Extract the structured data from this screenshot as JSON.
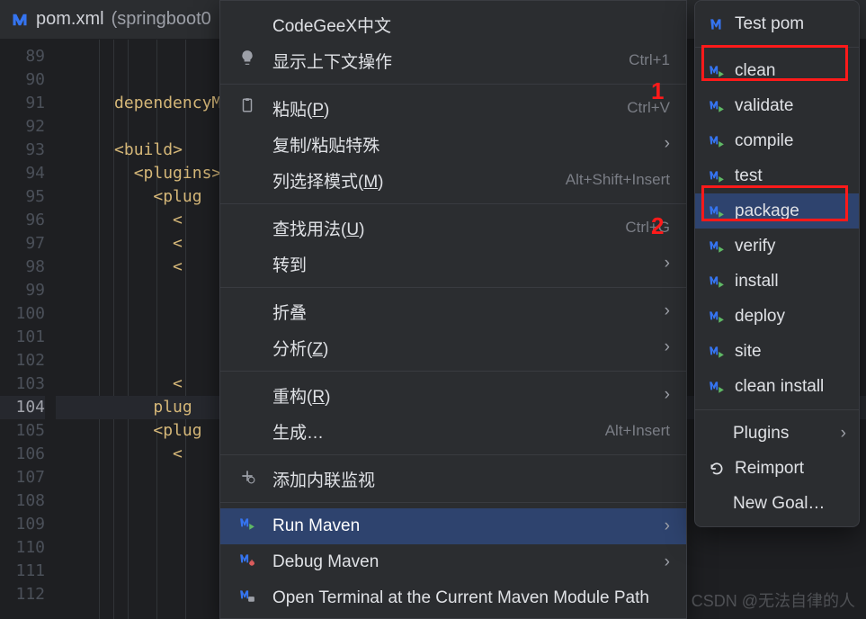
{
  "tab": {
    "filename": "pom.xml",
    "qualifier": " (springboot0"
  },
  "gutter": {
    "start": 89,
    "end": 112,
    "highlighted": 104
  },
  "code_lines": [
    {
      "i": 2,
      "text": "</dependencyMa"
    },
    {
      "i": 4,
      "text": "<build>"
    },
    {
      "i": 5,
      "text": "<plugins>"
    },
    {
      "i": 6,
      "text": "<plug"
    },
    {
      "i": 7,
      "text": "<"
    },
    {
      "i": 8,
      "text": "<"
    },
    {
      "i": 9,
      "text": "<"
    },
    {
      "i": 14,
      "text": "<"
    },
    {
      "i": 15,
      "text": "</plug"
    },
    {
      "i": 16,
      "text": "<plug"
    },
    {
      "i": 17,
      "text": "<"
    }
  ],
  "context_menu": [
    {
      "type": "item",
      "label": "CodeGeeX中文",
      "icon": ""
    },
    {
      "type": "item",
      "label": "显示上下文操作",
      "icon": "bulb",
      "shortcut": "Ctrl+1"
    },
    {
      "type": "sep"
    },
    {
      "type": "item",
      "label": "粘贴(P)",
      "icon": "clipboard",
      "shortcut": "Ctrl+V",
      "underline": "P"
    },
    {
      "type": "item",
      "label": "复制/粘贴特殊",
      "submenu": true
    },
    {
      "type": "item",
      "label": "列选择模式(M)",
      "shortcut": "Alt+Shift+Insert",
      "underline": "M"
    },
    {
      "type": "sep"
    },
    {
      "type": "item",
      "label": "查找用法(U)",
      "shortcut": "Ctrl+G",
      "underline": "U"
    },
    {
      "type": "item",
      "label": "转到",
      "submenu": true
    },
    {
      "type": "sep"
    },
    {
      "type": "item",
      "label": "折叠",
      "submenu": true
    },
    {
      "type": "item",
      "label": "分析(Z)",
      "submenu": true,
      "underline": "Z"
    },
    {
      "type": "sep"
    },
    {
      "type": "item",
      "label": "重构(R)",
      "submenu": true,
      "underline": "R"
    },
    {
      "type": "item",
      "label": "生成…",
      "shortcut": "Alt+Insert"
    },
    {
      "type": "sep"
    },
    {
      "type": "item",
      "label": "添加内联监视",
      "icon": "plus-debug"
    },
    {
      "type": "sep"
    },
    {
      "type": "item",
      "label": "Run Maven",
      "icon": "maven-run",
      "submenu": true,
      "selected": true
    },
    {
      "type": "item",
      "label": "Debug Maven",
      "icon": "maven-debug",
      "submenu": true
    },
    {
      "type": "item",
      "label": "Open Terminal at the Current Maven Module Path",
      "icon": "maven-term"
    }
  ],
  "submenu": {
    "title": {
      "label": "Test pom",
      "icon": "m"
    },
    "items": [
      {
        "label": "clean",
        "icon": "maven-run",
        "highlight": true
      },
      {
        "label": "validate",
        "icon": "maven-run"
      },
      {
        "label": "compile",
        "icon": "maven-run"
      },
      {
        "label": "test",
        "icon": "maven-run"
      },
      {
        "label": "package",
        "icon": "maven-run",
        "selected": true,
        "highlight": true
      },
      {
        "label": "verify",
        "icon": "maven-run"
      },
      {
        "label": "install",
        "icon": "maven-run"
      },
      {
        "label": "deploy",
        "icon": "maven-run"
      },
      {
        "label": "site",
        "icon": "maven-run"
      },
      {
        "label": "clean install",
        "icon": "maven-run"
      }
    ],
    "footer": [
      {
        "label": "Plugins",
        "submenu": true,
        "indent": true
      },
      {
        "label": "Reimport",
        "icon": "refresh"
      },
      {
        "label": "New Goal…",
        "indent": true
      }
    ]
  },
  "annotations": {
    "a1": "1",
    "a2": "2"
  },
  "watermark": "CSDN @无法自律的人"
}
